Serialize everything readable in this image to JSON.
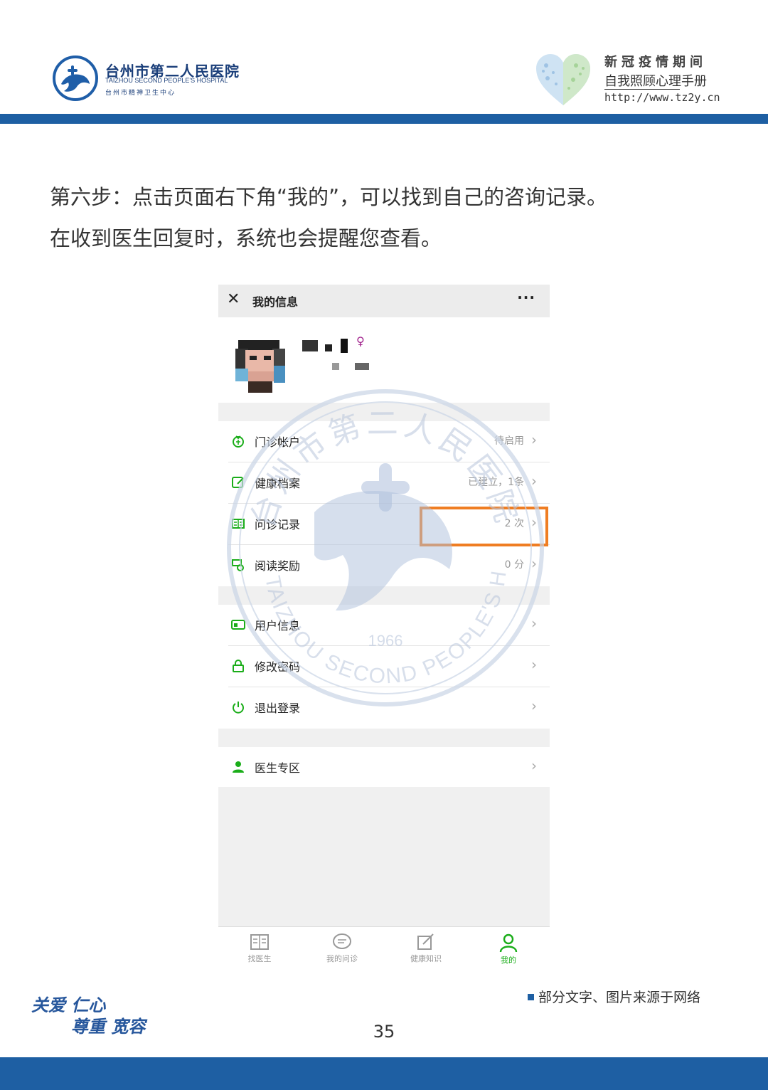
{
  "header": {
    "hospital_name_cn": "台州市第二人民医院",
    "hospital_name_en": "TAIZHOU SECOND PEOPLE'S HOSPITAL",
    "hospital_sub": "台州市精神卫生中心",
    "manual_line1": "新冠疫情期间",
    "manual_line2": "自我照顾心理手册",
    "manual_url": "http://www.tz2y.cn"
  },
  "instruction": {
    "line1": "第六步：点击页面右下角“我的”，可以找到自己的咨询记录。",
    "line2": "在收到医生回复时，系统也会提醒您查看。"
  },
  "phone": {
    "title": "我的信息",
    "close_glyph": "✕",
    "more_glyph": "···",
    "gender_symbol": "♀",
    "menu_group1": [
      {
        "label": "门诊帐户",
        "value": "待启用",
        "icon": "wallet-icon"
      },
      {
        "label": "健康档案",
        "value": "已建立，1条",
        "icon": "health-record-icon"
      },
      {
        "label": "问诊记录",
        "value": "2 次",
        "icon": "consult-record-icon"
      },
      {
        "label": "阅读奖励",
        "value": "0 分",
        "icon": "reward-icon"
      }
    ],
    "menu_group2": [
      {
        "label": "用户信息",
        "value": "",
        "icon": "id-card-icon"
      },
      {
        "label": "修改密码",
        "value": "",
        "icon": "lock-icon"
      },
      {
        "label": "退出登录",
        "value": "",
        "icon": "power-icon"
      }
    ],
    "menu_group3": [
      {
        "label": "医生专区",
        "value": "",
        "icon": "doctor-icon"
      }
    ],
    "tabs": [
      {
        "label": "找医生",
        "icon": "book-icon",
        "active": false
      },
      {
        "label": "我的问诊",
        "icon": "chat-icon",
        "active": false
      },
      {
        "label": "健康知识",
        "icon": "edit-icon",
        "active": false
      },
      {
        "label": "我的",
        "icon": "person-icon",
        "active": true
      }
    ],
    "accent_color": "#1aad19",
    "highlight_color": "#ef7d22"
  },
  "watermark": {
    "cn_text": "台州市第二人民医院",
    "en_text": "TAIZHOU SECOND PEOPLE'S HOSPITAL",
    "year": "1966"
  },
  "footer": {
    "source_note": "部分文字、图片来源于网络",
    "slogan_line1": "关爱 仁心",
    "slogan_line2": "尊重 宽容",
    "page_number": "35"
  },
  "colors": {
    "brand_blue": "#1e5fa3",
    "text": "#333333"
  }
}
